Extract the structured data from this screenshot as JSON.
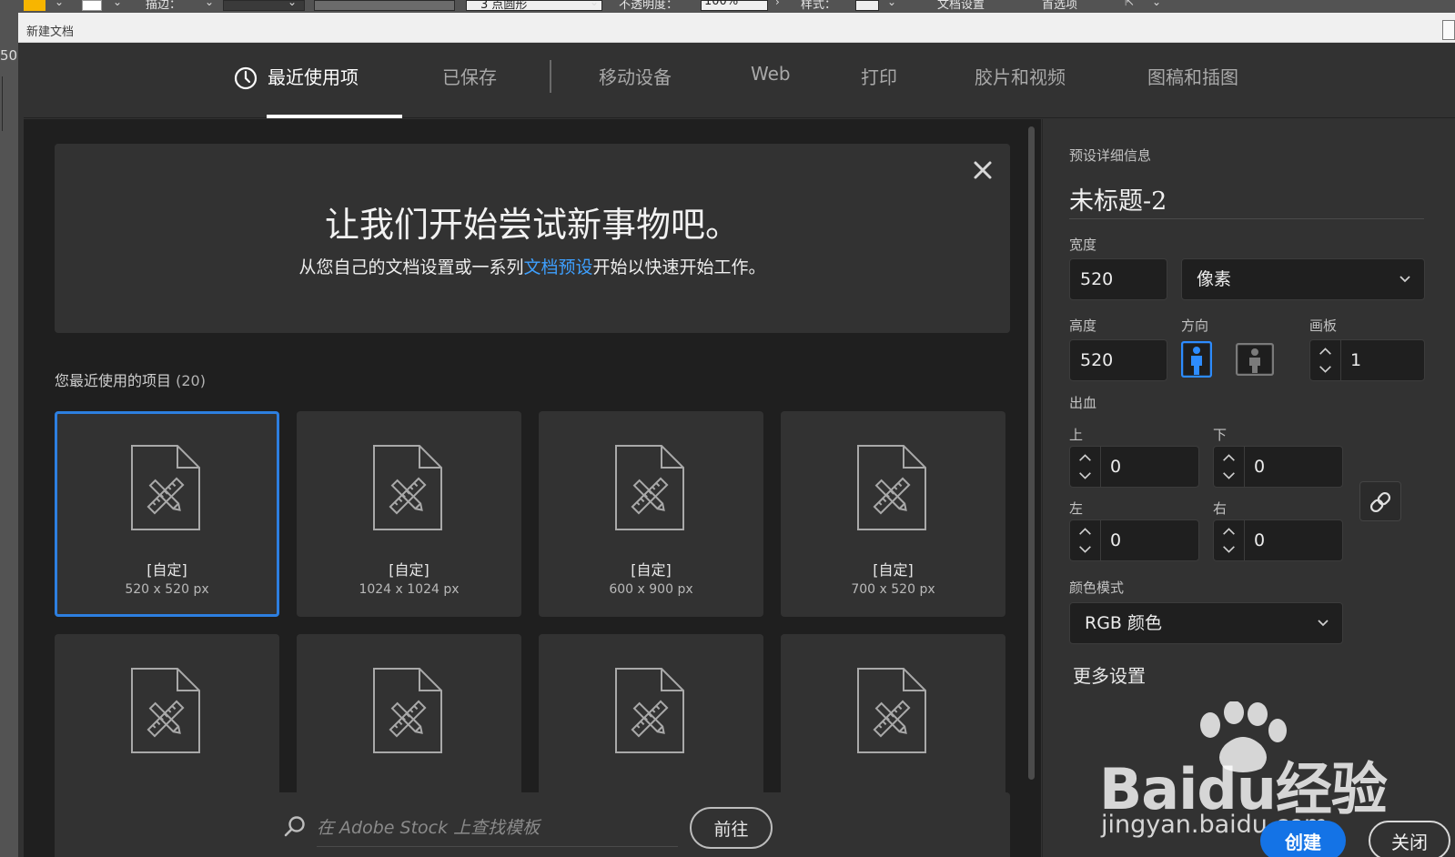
{
  "toolbar": {
    "stroke_label": "描边：",
    "points_label": "3 点圆形",
    "opacity_label": "不透明度：",
    "opacity_value": "100%",
    "style_label": "样式：",
    "doc_settings": "文档设置",
    "preferences": "首选项",
    "left_number": "50"
  },
  "dialog": {
    "title": "新建文档"
  },
  "tabs": [
    {
      "label": "最近使用项"
    },
    {
      "label": "已保存"
    },
    {
      "label": "移动设备"
    },
    {
      "label": "Web"
    },
    {
      "label": "打印"
    },
    {
      "label": "胶片和视频"
    },
    {
      "label": "图稿和插图"
    }
  ],
  "banner": {
    "title": "让我们开始尝试新事物吧。",
    "sub_before": "从您自己的文档设置或一系列",
    "sub_link": "文档预设",
    "sub_after": "开始以快速开始工作。"
  },
  "recent": {
    "label": "您最近使用的项目",
    "count": "(20)",
    "items": [
      {
        "name": "[自定]",
        "size": "520 x 520 px"
      },
      {
        "name": "[自定]",
        "size": "1024 x 1024 px"
      },
      {
        "name": "[自定]",
        "size": "600 x 900 px"
      },
      {
        "name": "[自定]",
        "size": "700 x 520 px"
      }
    ]
  },
  "search": {
    "placeholder": "在 Adobe Stock 上查找模板",
    "go_label": "前往"
  },
  "preset": {
    "section_label": "预设详细信息",
    "doc_name": "未标题-2",
    "width_label": "宽度",
    "width_value": "520",
    "unit_value": "像素",
    "height_label": "高度",
    "height_value": "520",
    "orientation_label": "方向",
    "artboards_label": "画板",
    "artboards_value": "1",
    "bleed_label": "出血",
    "bleed_top_label": "上",
    "bleed_top": "0",
    "bleed_bottom_label": "下",
    "bleed_bottom": "0",
    "bleed_left_label": "左",
    "bleed_left": "0",
    "bleed_right_label": "右",
    "bleed_right": "0",
    "color_mode_label": "颜色模式",
    "color_mode_value": "RGB 颜色",
    "more_settings": "更多设置",
    "create_label": "创建",
    "close_label": "关闭"
  },
  "watermark": {
    "brand": "Baidu经验",
    "url": "jingyan.baidu.com"
  },
  "colors": {
    "accent": "#1473e6",
    "link": "#3ea0ff",
    "selected_border": "#2d7fe0"
  }
}
